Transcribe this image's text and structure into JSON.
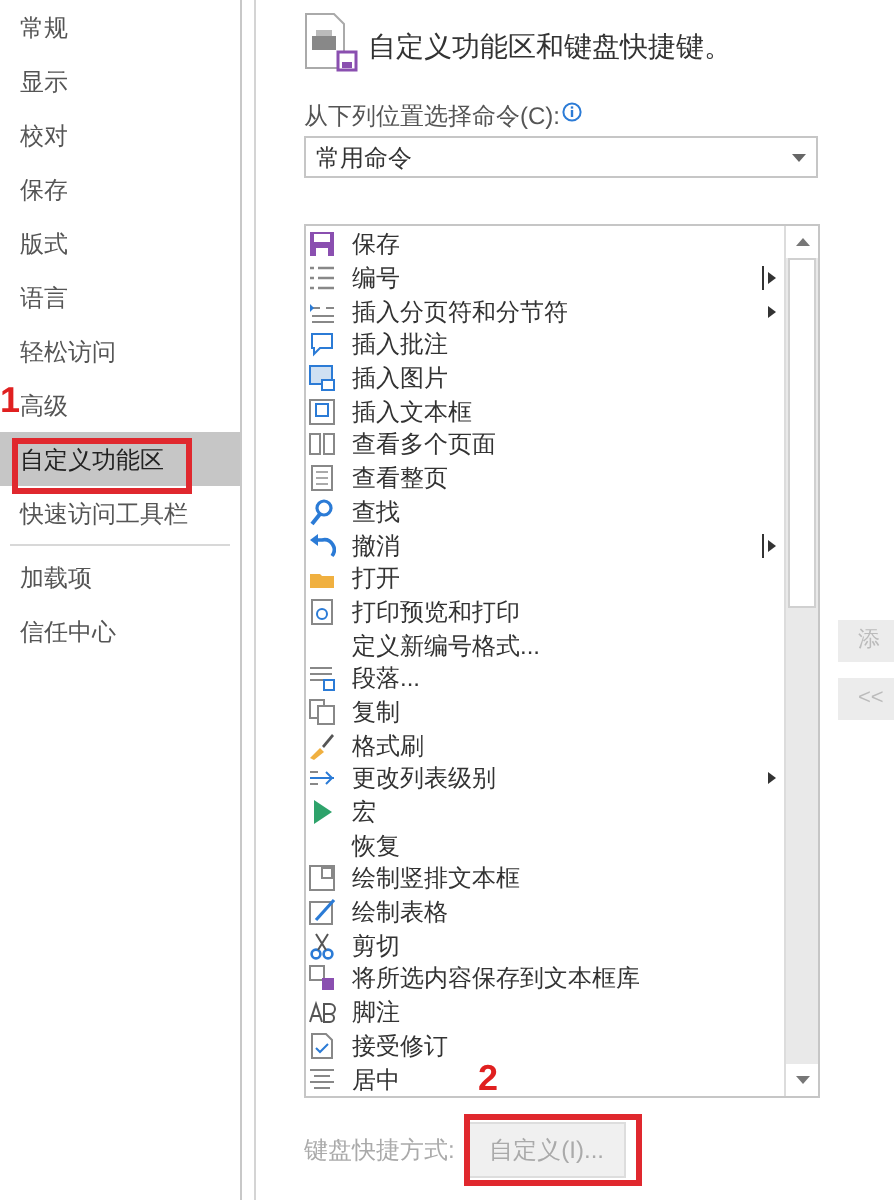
{
  "sidebar": {
    "items": [
      {
        "label": "常规",
        "selected": false
      },
      {
        "label": "显示",
        "selected": false
      },
      {
        "label": "校对",
        "selected": false
      },
      {
        "label": "保存",
        "selected": false
      },
      {
        "label": "版式",
        "selected": false
      },
      {
        "label": "语言",
        "selected": false
      },
      {
        "label": "轻松访问",
        "selected": false
      },
      {
        "label": "高级",
        "selected": false
      },
      {
        "label": "自定义功能区",
        "selected": true
      },
      {
        "label": "快速访问工具栏",
        "selected": false
      },
      {
        "label": "加载项",
        "selected": false
      },
      {
        "label": "信任中心",
        "selected": false
      }
    ]
  },
  "header": {
    "title": "自定义功能区和键盘快捷键。"
  },
  "command_source": {
    "label": "从下列位置选择命令(C):",
    "value": "常用命令"
  },
  "commands": [
    {
      "label": "保存",
      "kind": "plain"
    },
    {
      "label": "编号",
      "kind": "split"
    },
    {
      "label": "插入分页符和分节符",
      "kind": "submenu"
    },
    {
      "label": "插入批注",
      "kind": "plain"
    },
    {
      "label": "插入图片",
      "kind": "plain"
    },
    {
      "label": "插入文本框",
      "kind": "plain"
    },
    {
      "label": "查看多个页面",
      "kind": "plain"
    },
    {
      "label": "查看整页",
      "kind": "plain"
    },
    {
      "label": "查找",
      "kind": "plain"
    },
    {
      "label": "撤消",
      "kind": "split"
    },
    {
      "label": "打开",
      "kind": "plain"
    },
    {
      "label": "打印预览和打印",
      "kind": "plain"
    },
    {
      "label": "定义新编号格式...",
      "kind": "plain"
    },
    {
      "label": "段落...",
      "kind": "plain"
    },
    {
      "label": "复制",
      "kind": "plain"
    },
    {
      "label": "格式刷",
      "kind": "plain"
    },
    {
      "label": "更改列表级别",
      "kind": "submenu"
    },
    {
      "label": "宏",
      "kind": "plain"
    },
    {
      "label": "恢复",
      "kind": "plain"
    },
    {
      "label": "绘制竖排文本框",
      "kind": "plain"
    },
    {
      "label": "绘制表格",
      "kind": "plain"
    },
    {
      "label": "剪切",
      "kind": "plain"
    },
    {
      "label": "将所选内容保存到文本框库",
      "kind": "plain"
    },
    {
      "label": "脚注",
      "kind": "plain"
    },
    {
      "label": "接受修订",
      "kind": "plain"
    },
    {
      "label": "居中",
      "kind": "plain"
    }
  ],
  "side_buttons": [
    {
      "label": "添",
      "disabled": true
    },
    {
      "label": "<<",
      "disabled": true
    }
  ],
  "shortcuts": {
    "label": "键盘快捷方式:",
    "button": {
      "label": "自定义(I)...",
      "disabled": true
    }
  },
  "annotations": [
    {
      "label": "1"
    },
    {
      "label": "2"
    }
  ]
}
